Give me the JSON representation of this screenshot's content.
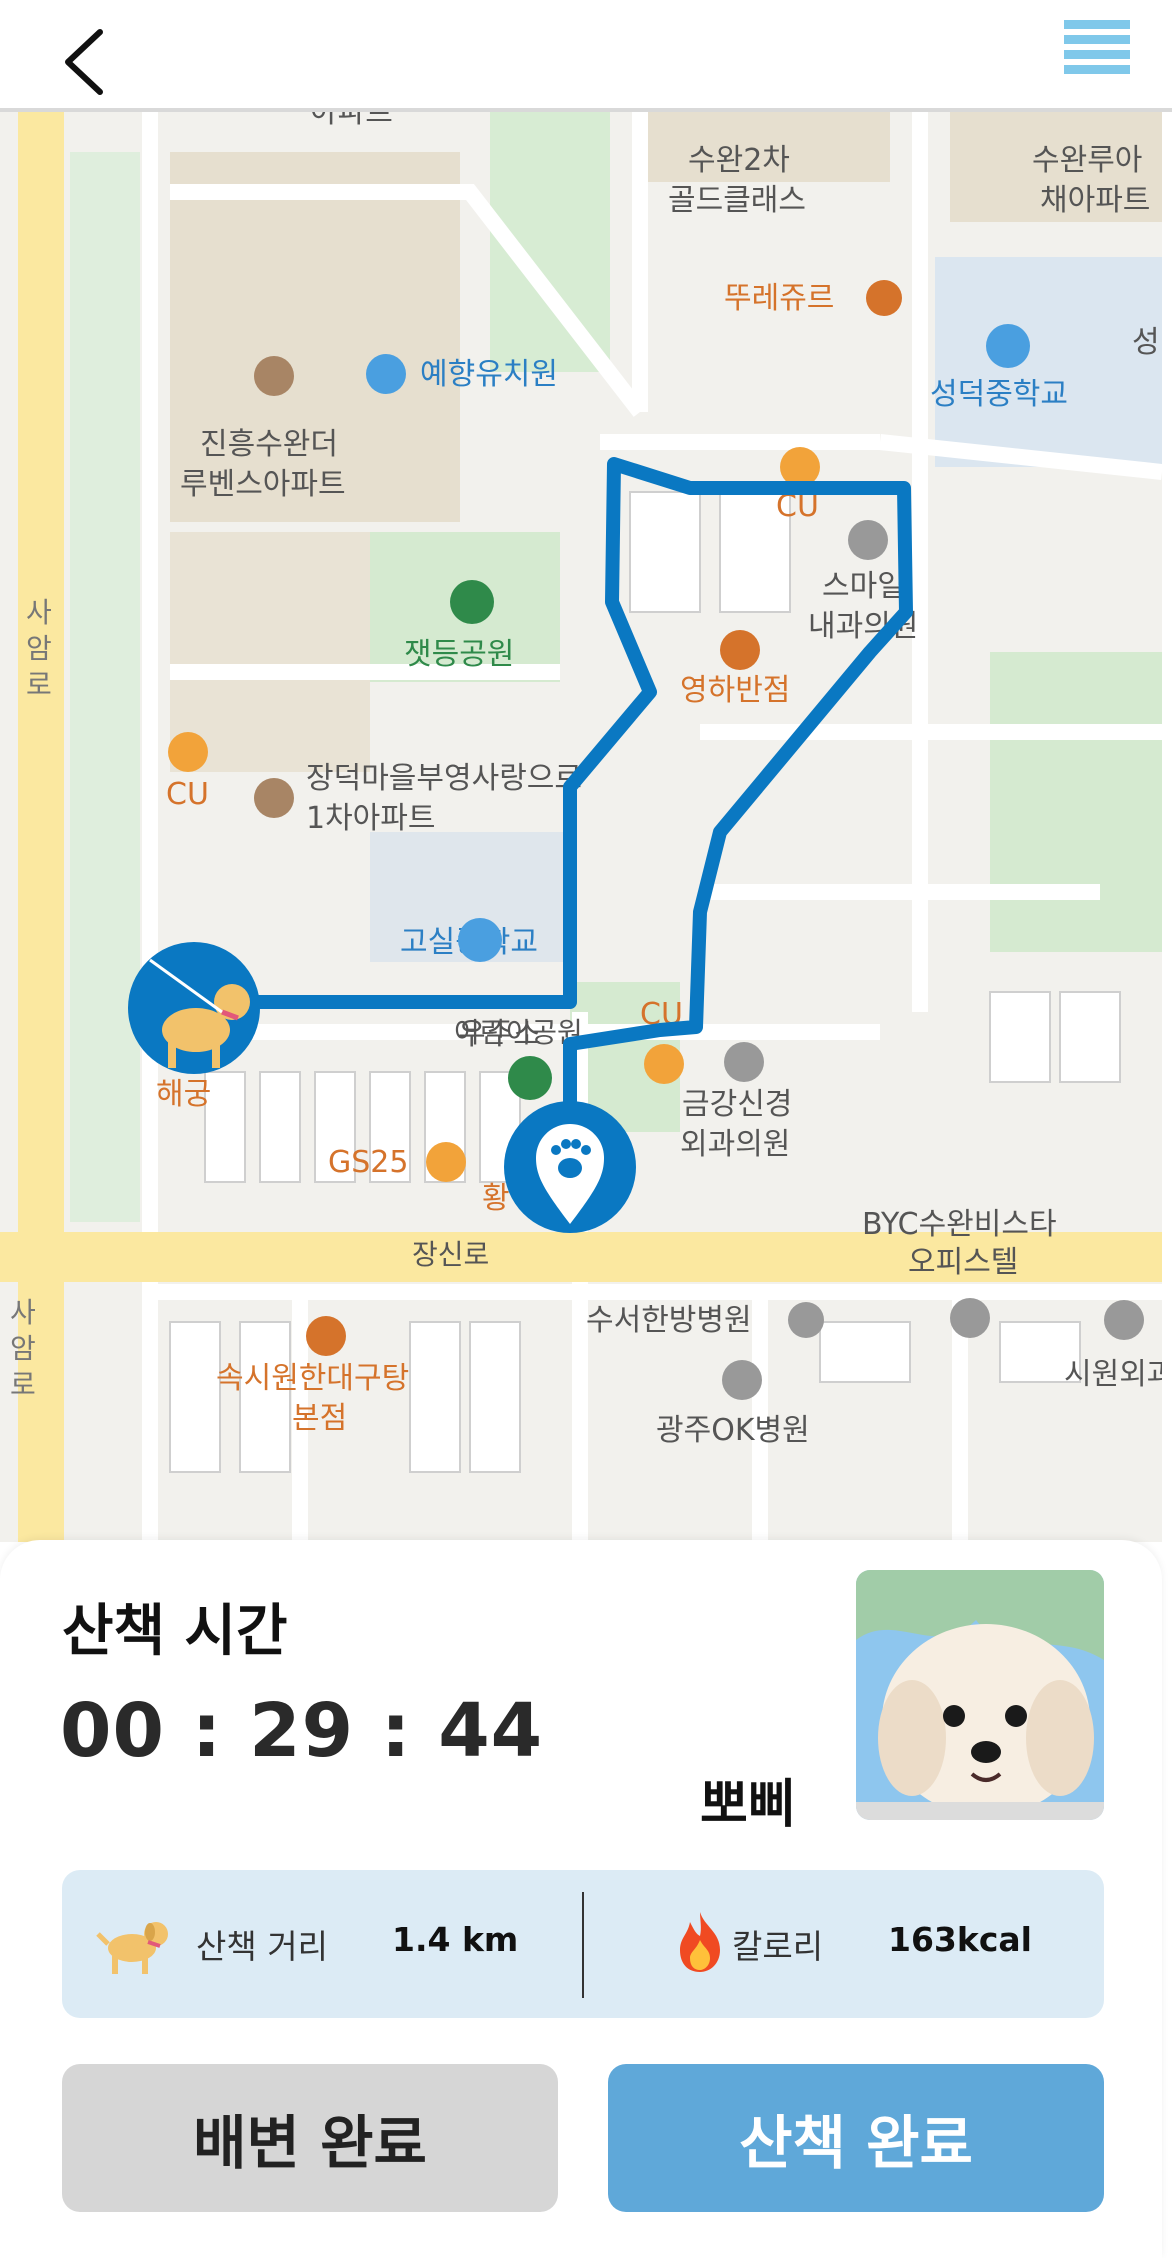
{
  "header": {
    "back_icon": "chevron-left-icon",
    "menu_icon": "hamburger-menu-icon",
    "menu_color": "#7fc8ea"
  },
  "map": {
    "route_color": "#0a78c2",
    "roads": [
      "장신로",
      "사암로",
      "사암로"
    ],
    "places": [
      "아파트",
      "수완2차",
      "골드클래스",
      "수완루아",
      "채아파트",
      "뚜레쥬르",
      "성",
      "예향유치원",
      "성덕중학교",
      "진흥수완더",
      "루벤스아파트",
      "CU",
      "스마일",
      "내과의원",
      "잿등공원",
      "영하반점",
      "CU",
      "장덕마을부영사랑으로",
      "1차아파트",
      "고실중학교",
      "우주소",
      "어린이공원",
      "CU",
      "GS25",
      "황",
      "금강신경",
      "외과의원",
      "BYC수완비스타",
      "오피스텔",
      "수서한방병원",
      "시원외과",
      "속시원한대구탕",
      "본점",
      "광주OK병원"
    ],
    "dog_marker_label": "해궁"
  },
  "walk": {
    "title": "산책 시간",
    "timer": "00 : 29 : 44",
    "dog_name": "뽀삐"
  },
  "stats": {
    "distance_icon": "dog-icon",
    "distance_label": "산책 거리",
    "distance_value": "1.4 km",
    "calorie_icon": "fire-icon",
    "calorie_label": "칼로리",
    "calorie_value": "163kcal"
  },
  "buttons": {
    "potty_label": "배변 완료",
    "finish_label": "산책 완료"
  },
  "colors": {
    "stats_bg": "#dcebf5",
    "potty_bg": "#d6d6d6",
    "finish_bg": "#5fa8d9"
  }
}
